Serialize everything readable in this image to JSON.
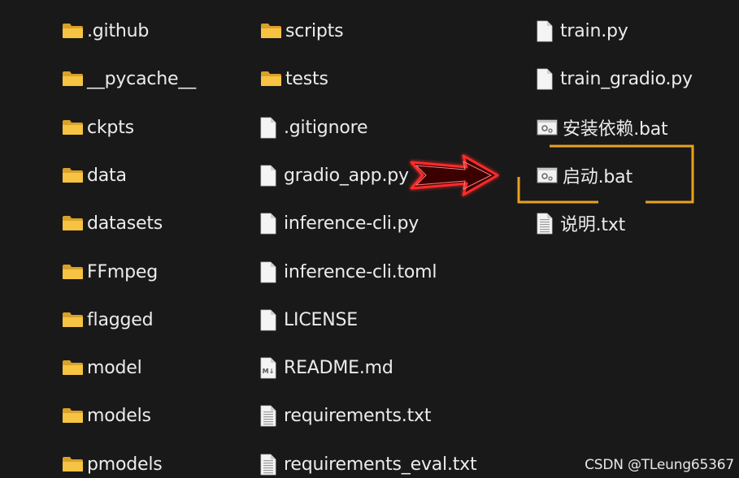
{
  "columns": [
    {
      "items": [
        {
          "name": ".github",
          "type": "folder"
        },
        {
          "name": "__pycache__",
          "type": "folder"
        },
        {
          "name": "ckpts",
          "type": "folder"
        },
        {
          "name": "data",
          "type": "folder"
        },
        {
          "name": "datasets",
          "type": "folder"
        },
        {
          "name": "FFmpeg",
          "type": "folder"
        },
        {
          "name": "flagged",
          "type": "folder"
        },
        {
          "name": "model",
          "type": "folder"
        },
        {
          "name": "models",
          "type": "folder"
        },
        {
          "name": "pmodels",
          "type": "folder"
        }
      ]
    },
    {
      "items": [
        {
          "name": "scripts",
          "type": "folder"
        },
        {
          "name": "tests",
          "type": "folder"
        },
        {
          "name": ".gitignore",
          "type": "file"
        },
        {
          "name": "gradio_app.py",
          "type": "file"
        },
        {
          "name": "inference-cli.py",
          "type": "file"
        },
        {
          "name": "inference-cli.toml",
          "type": "file"
        },
        {
          "name": "LICENSE",
          "type": "file"
        },
        {
          "name": "README.md",
          "type": "markdown"
        },
        {
          "name": "requirements.txt",
          "type": "text"
        },
        {
          "name": "requirements_eval.txt",
          "type": "text"
        }
      ]
    },
    {
      "items": [
        {
          "name": "train.py",
          "type": "file"
        },
        {
          "name": "train_gradio.py",
          "type": "file"
        },
        {
          "name": "安装依赖.bat",
          "type": "batch"
        },
        {
          "name": "启动.bat",
          "type": "batch",
          "highlighted": true
        },
        {
          "name": "说明.txt",
          "type": "text"
        }
      ]
    }
  ],
  "watermark": "CSDN @TLeung65367",
  "colors": {
    "background": "#191919",
    "folder": "#f6c343",
    "highlight_box": "#e8a21f",
    "arrow": "#ff2a2a"
  },
  "icons": {
    "folder": "folder-icon",
    "file": "file-icon",
    "text": "text-file-icon",
    "markdown": "markdown-file-icon",
    "batch": "batch-file-icon"
  }
}
